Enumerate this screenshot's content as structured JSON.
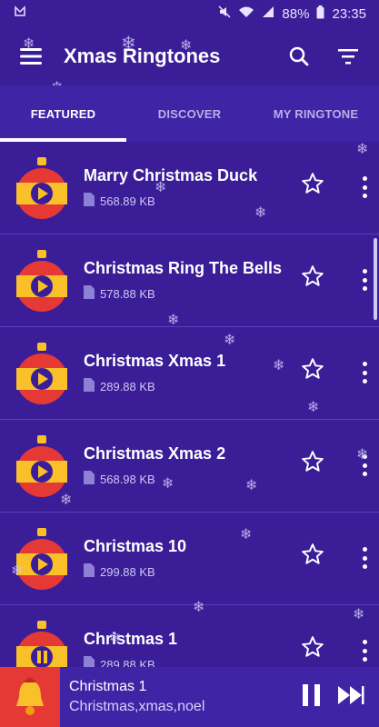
{
  "status": {
    "battery": "88%",
    "time": "23:35"
  },
  "appbar": {
    "title": "Xmas Ringtones"
  },
  "tabs": [
    {
      "label": "FEATURED",
      "active": true
    },
    {
      "label": "DISCOVER",
      "active": false
    },
    {
      "label": "MY RINGTONE",
      "active": false
    }
  ],
  "ringtones": [
    {
      "title": "Marry Christmas Duck",
      "size": "568.89 KB",
      "playing": false
    },
    {
      "title": "Christmas Ring The Bells",
      "size": "578.88 KB",
      "playing": false
    },
    {
      "title": "Christmas Xmas 1",
      "size": "289.88 KB",
      "playing": false
    },
    {
      "title": "Christmas Xmas 2",
      "size": "568.98 KB",
      "playing": false
    },
    {
      "title": "Christmas 10",
      "size": "299.88 KB",
      "playing": false
    },
    {
      "title": "Christmas 1",
      "size": "289.88 KB",
      "playing": true
    }
  ],
  "player": {
    "title": "Christmas 1",
    "tags": "Christmas,xmas,noel"
  },
  "colors": {
    "background": "#3a1d97",
    "tabbar": "#3f25a6",
    "ornament_red": "#e53935",
    "ornament_yellow": "#f9c02a",
    "player_art": "#e53935"
  }
}
